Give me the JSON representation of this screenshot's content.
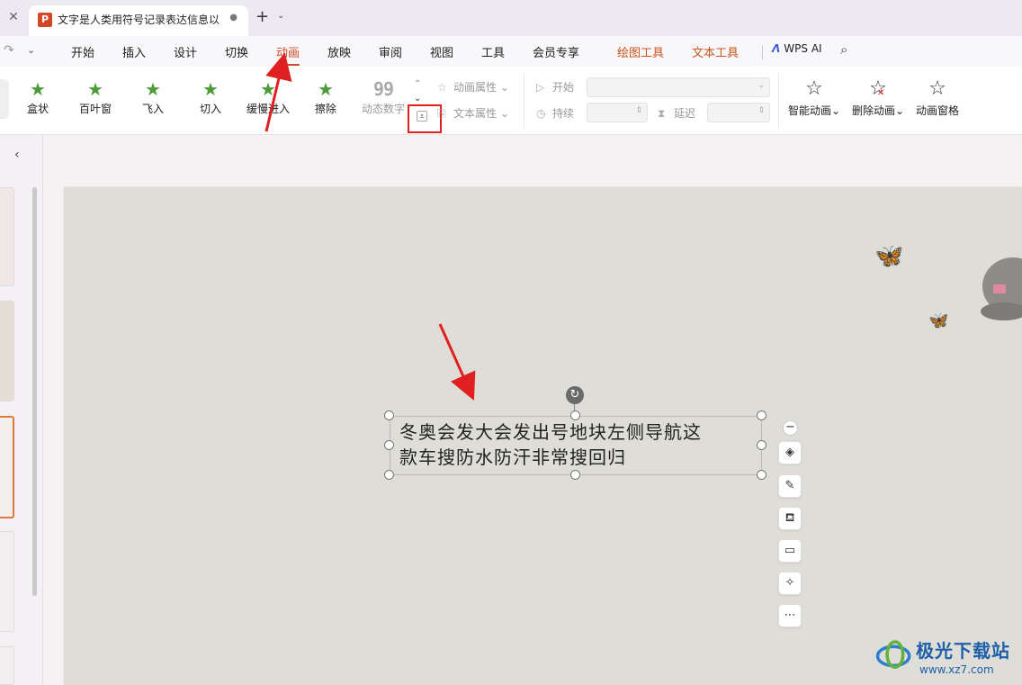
{
  "titlebar": {
    "doc_tab_icon": "P",
    "doc_tab_title": "文字是人类用符号记录表达信息以",
    "unsaved_dot": "●",
    "new_tab": "+",
    "close_left": "✕"
  },
  "menubar": {
    "items": [
      "开始",
      "插入",
      "设计",
      "切换",
      "动画",
      "放映",
      "审阅",
      "视图",
      "工具",
      "会员专享"
    ],
    "contextual": [
      "绘图工具",
      "文本工具"
    ],
    "active": "动画",
    "wps_ai": "WPS AI"
  },
  "ribbon": {
    "effects": [
      {
        "label": "盒状"
      },
      {
        "label": "百叶窗"
      },
      {
        "label": "飞入"
      },
      {
        "label": "切入"
      },
      {
        "label": "缓慢进入"
      },
      {
        "label": "擦除"
      }
    ],
    "dynamic_digits": {
      "icon": "99",
      "label": "动态数字"
    },
    "anim_props": "动画属性",
    "text_props": "文本属性",
    "start_label": "开始",
    "duration_label": "持续",
    "delay_label": "延迟",
    "smart_anim": "智能动画",
    "delete_anim": "删除动画",
    "anim_pane": "动画窗格"
  },
  "slide": {
    "text_line1": "冬奥会发大会发出号地块左侧导航这",
    "text_line2": "款车搜防水防汗非常搜回归"
  },
  "watermark": {
    "title": "极光下载站",
    "url": "www.xz7.com"
  },
  "colors": {
    "accent": "#d24726",
    "annotation_red": "#e02020",
    "star_green": "#4d9a3a"
  }
}
